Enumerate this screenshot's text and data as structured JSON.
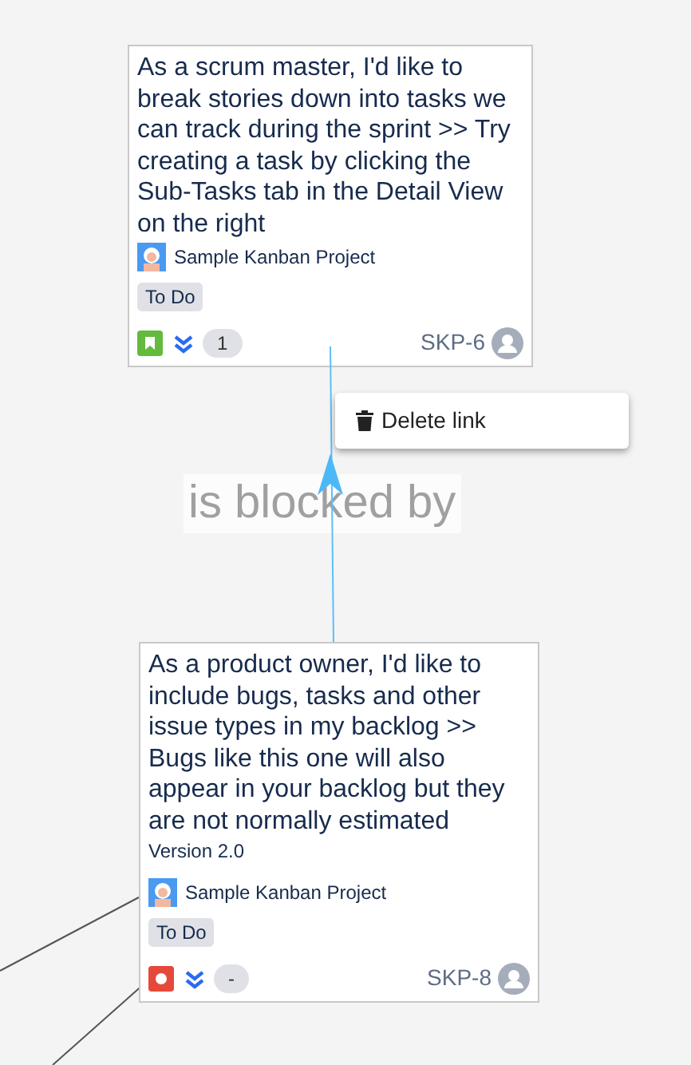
{
  "cards": [
    {
      "title": "As a scrum master, I'd like to break stories down into tasks we can track during the sprint >> Try creating a task by clicking the Sub-Tasks tab in the Detail View on the right",
      "project": "Sample Kanban Project",
      "status": "To Do",
      "kind": "story",
      "count": "1",
      "key": "SKP-6"
    },
    {
      "title": "As a product owner, I'd like to include bugs, tasks and other issue types in my backlog >> Bugs like this one will also appear in your backlog but they are not normally estimated",
      "version": "Version 2.0",
      "project": "Sample Kanban Project",
      "status": "To Do",
      "kind": "bug",
      "count": "-",
      "key": "SKP-8"
    }
  ],
  "link": {
    "label": "is blocked by"
  },
  "context_menu": {
    "items": [
      "Delete link"
    ]
  }
}
